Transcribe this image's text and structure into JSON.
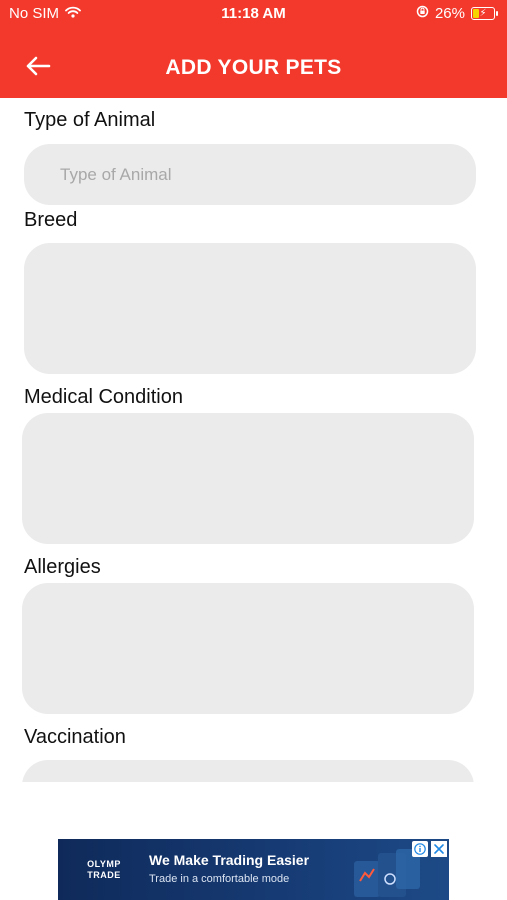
{
  "status_bar": {
    "carrier": "No SIM",
    "time": "11:18 AM",
    "battery": "26%",
    "battery_level": 0.26,
    "icons": [
      "wifi-icon",
      "rotation-lock-icon",
      "battery-charging-icon"
    ]
  },
  "header": {
    "title": "ADD YOUR PETS",
    "back_icon": "arrow-left-icon",
    "color": "#f2392c"
  },
  "form": {
    "fields": [
      {
        "label": "Type of Animal",
        "placeholder": "Type of Animal",
        "value": ""
      },
      {
        "label": "Breed",
        "value": ""
      },
      {
        "label": "Medical Condition",
        "value": ""
      },
      {
        "label": "Allergies",
        "value": ""
      },
      {
        "label": "Vaccination",
        "value": ""
      }
    ],
    "field_color": "#ebebeb"
  },
  "ad": {
    "brand_line1": "OLYMP",
    "brand_line2": "TRADE",
    "headline": "We Make Trading Easier",
    "subtext": "Trade in a comfortable mode",
    "icons": [
      "ad-info-icon",
      "close-icon"
    ]
  }
}
